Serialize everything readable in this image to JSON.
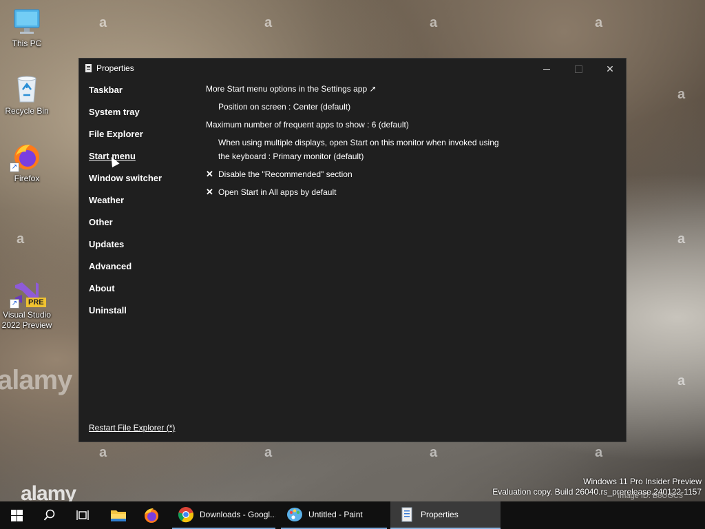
{
  "desktop": {
    "icons": [
      {
        "label": "This PC",
        "icon": "monitor-icon"
      },
      {
        "label": "Recycle Bin",
        "icon": "recycle-bin-icon"
      },
      {
        "label": "Firefox",
        "icon": "firefox-icon"
      },
      {
        "label": "Visual Studio 2022 Preview",
        "icon": "visual-studio-icon",
        "badge": "PRE"
      }
    ],
    "watermark_small": "a",
    "watermark_brand": "alamy",
    "eval_line1": "Windows 11 Pro Insider Preview",
    "eval_line2": "Evaluation copy. Build 26040.rs_prerelease.240122-1157",
    "image_id": "Image ID: B8UGC3"
  },
  "window": {
    "title": "Properties",
    "controls": {
      "minimize": "minimize",
      "maximize": "maximize",
      "close": "✕"
    },
    "nav": [
      "Taskbar",
      "System tray",
      "File Explorer",
      "Start menu",
      "Window switcher",
      "Weather",
      "Other",
      "Updates",
      "Advanced",
      "About",
      "Uninstall"
    ],
    "active_nav": "Start menu",
    "restart_link": "Restart File Explorer (*)",
    "content": {
      "settings_link": "More Start menu options in the Settings app ↗",
      "position": "Position on screen : Center (default)",
      "frequent": "Maximum number of frequent apps to show : 6 (default)",
      "multi_display_1": "When using multiple displays, open Start on this monitor when invoked using",
      "multi_display_2": "the keyboard : Primary monitor (default)",
      "check_mark": "✕",
      "disable_recommended": "Disable the \"Recommended\" section",
      "open_all_apps": "Open Start in All apps by default"
    }
  },
  "taskbar": {
    "apps": [
      {
        "label": "Downloads - Googl...",
        "icon": "chrome-icon"
      },
      {
        "label": "Untitled - Paint",
        "icon": "paint-icon"
      },
      {
        "label": "Properties",
        "icon": "properties-icon"
      }
    ]
  }
}
